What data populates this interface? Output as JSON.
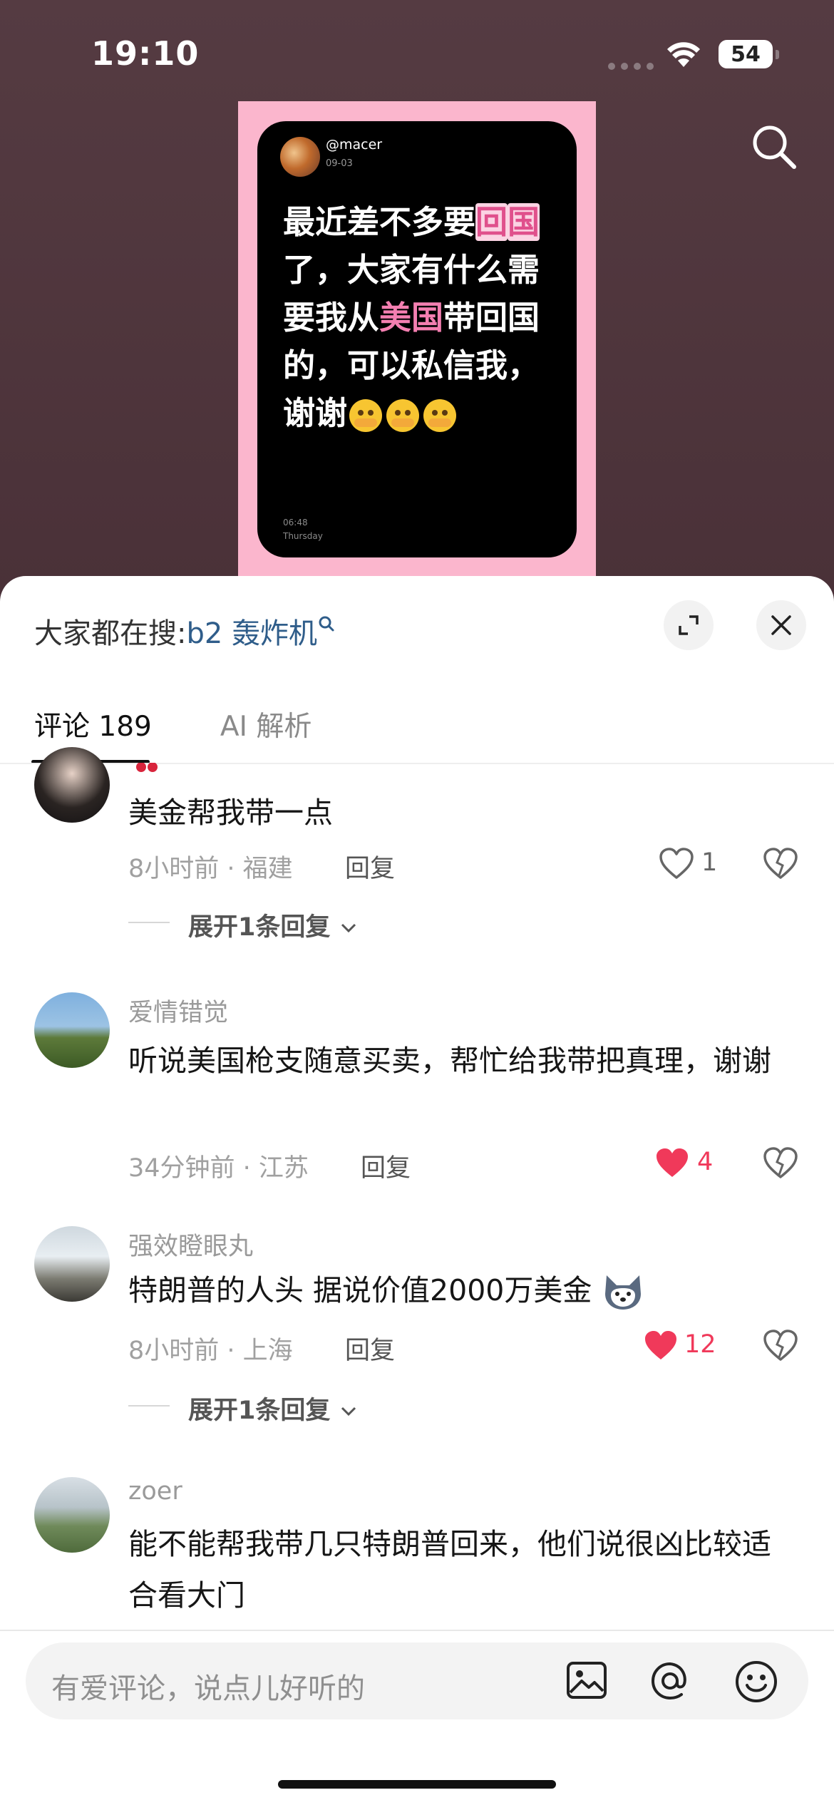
{
  "status_bar": {
    "time": "19:10",
    "battery": "54"
  },
  "post": {
    "username": "@macer",
    "date": "09-03",
    "text_segments": [
      {
        "t": "最近差不多要",
        "style": "normal"
      },
      {
        "t": "回",
        "style": "pink-bg"
      },
      {
        "t": "国",
        "style": "pink-bg"
      },
      {
        "t": "了，大家有什么需要我从",
        "style": "normal"
      },
      {
        "t": "美国",
        "style": "pink"
      },
      {
        "t": "带回国的，可以私信我，谢谢",
        "style": "normal"
      }
    ],
    "time": "06:48",
    "day": "Thursday"
  },
  "sheet": {
    "search_prefix": "大家都在搜:",
    "search_keyword": "b2 轰炸机",
    "tabs": [
      {
        "label": "评论 189",
        "active": true
      },
      {
        "label": "AI 解析",
        "active": false
      }
    ]
  },
  "comments": [
    {
      "name": "",
      "text": "美金帮我带一点",
      "time_location": "8小时前 · 福建",
      "reply_label": "回复",
      "likes": "1",
      "liked": false,
      "expand_label": "展开1条回复"
    },
    {
      "name": "爱情错觉",
      "text": "听说美国枪支随意买卖，帮忙给我带把真理，谢谢",
      "time_location": "34分钟前 · 江苏",
      "reply_label": "回复",
      "likes": "4",
      "liked": true
    },
    {
      "name": "强效瞪眼丸",
      "text": "特朗普的人头 据说价值2000万美金",
      "time_location": "8小时前 · 上海",
      "reply_label": "回复",
      "likes": "12",
      "liked": true,
      "expand_label": "展开1条回复"
    },
    {
      "name": "zoer",
      "text": "能不能帮我带几只特朗普回来，他们说很凶比较适合看大门"
    }
  ],
  "input": {
    "placeholder": "有爱评论，说点儿好听的"
  },
  "colors": {
    "like_red": "#f0395a",
    "keyword_blue": "#2f5d8a",
    "post_pink": "#fbb6cd"
  }
}
